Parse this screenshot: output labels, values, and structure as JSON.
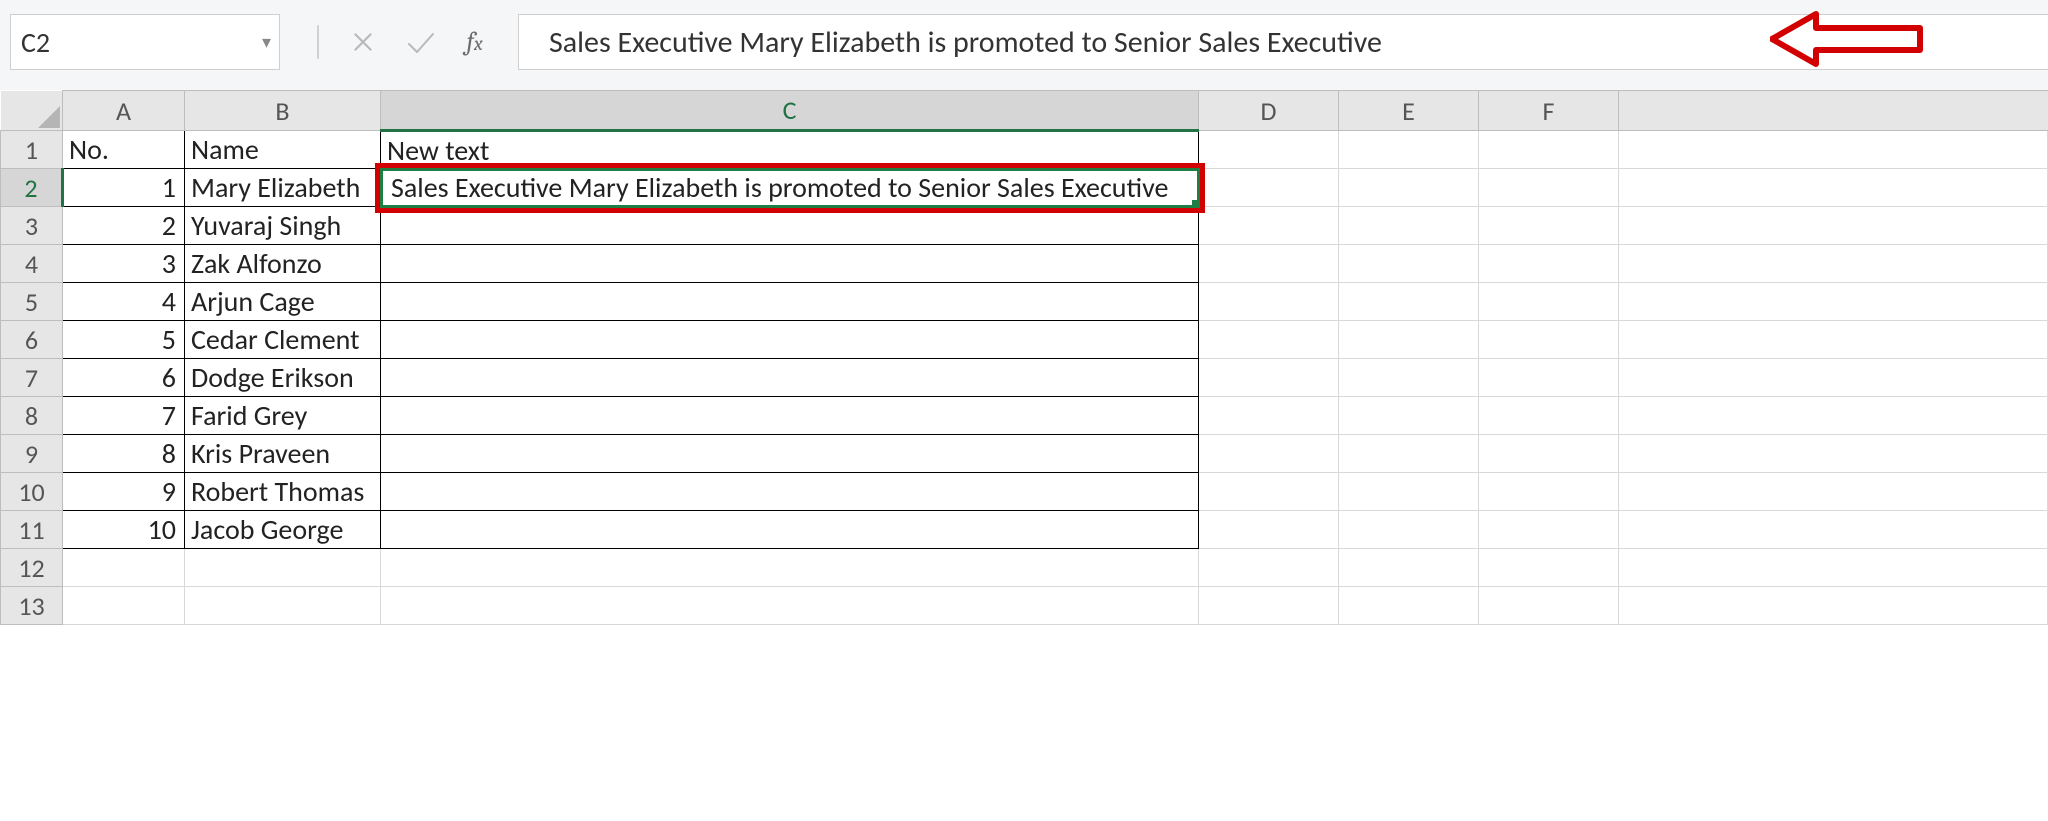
{
  "formula_bar": {
    "name_box": "C2",
    "formula": "Sales Executive Mary Elizabeth is promoted to Senior Sales Executive"
  },
  "columns": {
    "A": "A",
    "B": "B",
    "C": "C",
    "D": "D",
    "E": "E",
    "F": "F"
  },
  "row_numbers": [
    "1",
    "2",
    "3",
    "4",
    "5",
    "6",
    "7",
    "8",
    "9",
    "10",
    "11",
    "12",
    "13"
  ],
  "headers": {
    "A": "No.",
    "B": "Name",
    "C": "New text"
  },
  "rows": [
    {
      "no": "1",
      "name": "Mary Elizabeth",
      "newtext": "Sales Executive Mary Elizabeth is promoted to Senior Sales Executive"
    },
    {
      "no": "2",
      "name": "Yuvaraj Singh",
      "newtext": ""
    },
    {
      "no": "3",
      "name": "Zak Alfonzo",
      "newtext": ""
    },
    {
      "no": "4",
      "name": "Arjun Cage",
      "newtext": ""
    },
    {
      "no": "5",
      "name": "Cedar Clement",
      "newtext": ""
    },
    {
      "no": "6",
      "name": "Dodge Erikson",
      "newtext": ""
    },
    {
      "no": "7",
      "name": "Farid Grey",
      "newtext": ""
    },
    {
      "no": "8",
      "name": "Kris Praveen",
      "newtext": ""
    },
    {
      "no": "9",
      "name": "Robert Thomas",
      "newtext": ""
    },
    {
      "no": "10",
      "name": "Jacob George",
      "newtext": ""
    }
  ],
  "active_cell": "C2",
  "highlight_cell": "C2",
  "annotations": {
    "arrow_label": "arrow"
  }
}
